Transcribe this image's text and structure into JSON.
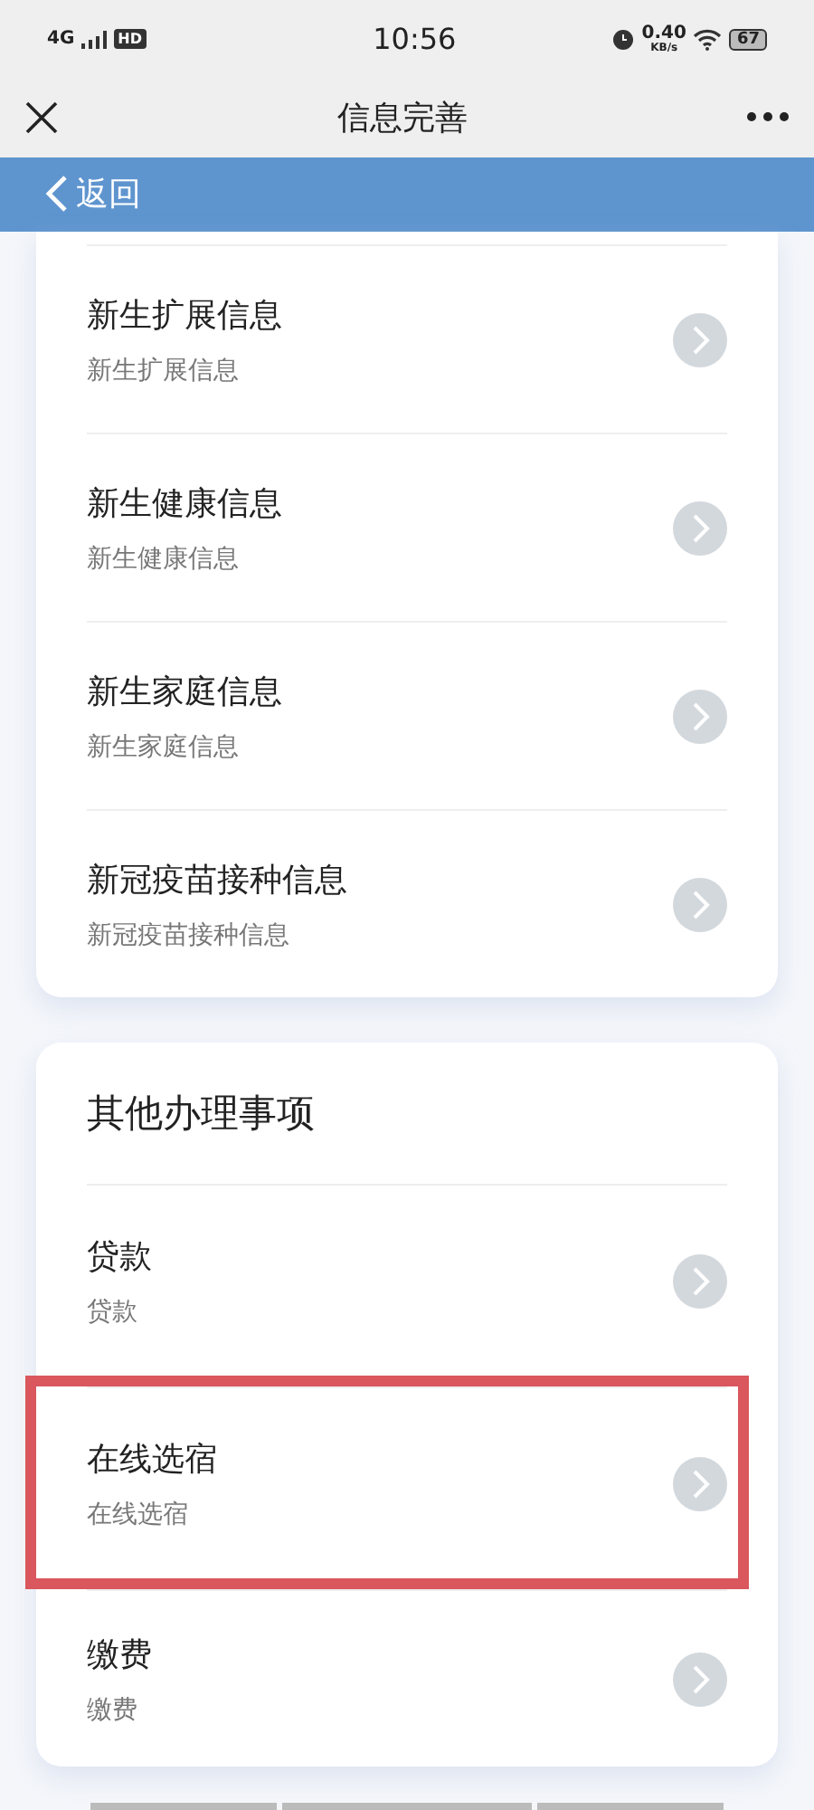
{
  "status_bar": {
    "network": "4G",
    "hd": "HD",
    "time": "10:56",
    "speed": "0.40",
    "speed_unit": "KB/s",
    "battery": "67"
  },
  "nav_bar": {
    "title": "信息完善"
  },
  "back_bar": {
    "label": "返回"
  },
  "sections": [
    {
      "items": [
        {
          "title": "新生扩展信息",
          "subtitle": "新生扩展信息",
          "highlighted": false
        },
        {
          "title": "新生健康信息",
          "subtitle": "新生健康信息",
          "highlighted": false
        },
        {
          "title": "新生家庭信息",
          "subtitle": "新生家庭信息",
          "highlighted": false
        },
        {
          "title": "新冠疫苗接种信息",
          "subtitle": "新冠疫苗接种信息",
          "highlighted": false
        }
      ]
    },
    {
      "title": "其他办理事项",
      "items": [
        {
          "title": "贷款",
          "subtitle": "贷款",
          "highlighted": false
        },
        {
          "title": "在线选宿",
          "subtitle": "在线选宿",
          "highlighted": true
        },
        {
          "title": "缴费",
          "subtitle": "缴费",
          "highlighted": false
        }
      ]
    }
  ]
}
